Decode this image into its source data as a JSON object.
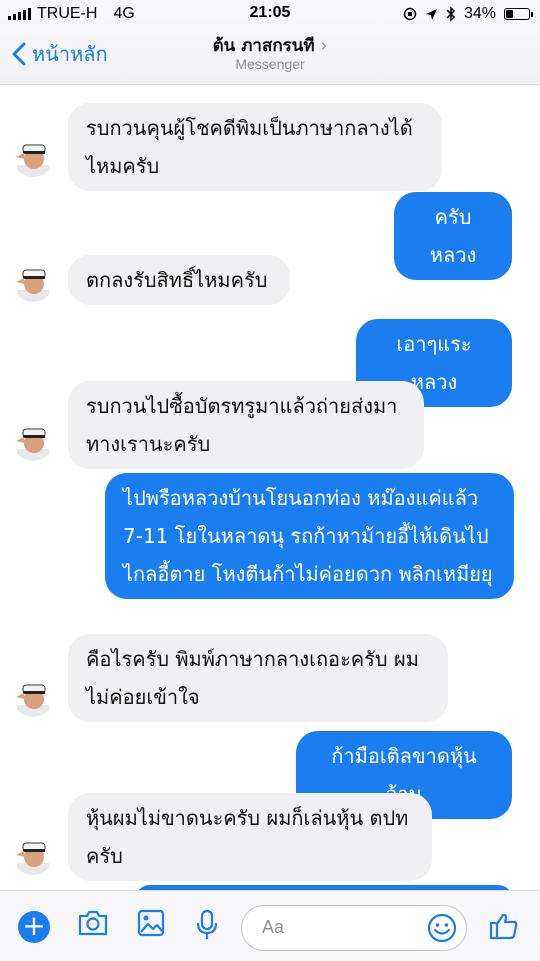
{
  "status_bar": {
    "carrier": "TRUE-H",
    "network": "4G",
    "time": "21:05",
    "battery": "34%"
  },
  "header": {
    "back_label": "หน้าหลัก",
    "contact_name": "ต้น ภาสกรนที",
    "subtitle": "Messenger"
  },
  "messages": [
    {
      "side": "in",
      "text": "รบกวนคุนผู้โชคดีพิมเป็นภาษากลางได้ไหมครับ"
    },
    {
      "side": "out",
      "text": "ครับหลวง"
    },
    {
      "side": "in",
      "text": "ตกลงรับสิทธิ์ไหมครับ"
    },
    {
      "side": "out",
      "text": "เอาๆแระหลวง"
    },
    {
      "side": "in",
      "text": "รบกวนไปซื้อบัตรทรูมาแล้วถ่ายส่งมาทางเรานะครับ"
    },
    {
      "side": "out",
      "text": "ไปพรือหลวงบ้านโยนอกท่อง หม๊องแค่แล้ว 7-11 โยในหลาดนุ รถก้าหาม้ายอี้ไห้เดินไปไกลอี้ตาย โหงตีนก้าไม่ค่อยดวก พลิกเหมียยุ"
    },
    {
      "side": "in",
      "text": "คือไรครับ พิมพ์ภาษากลางเถอะครับ ผมไม่ค่อยเข้าใจ"
    },
    {
      "side": "out",
      "text": "ก้ามือเติลขาดหุ้นจ้าน"
    },
    {
      "side": "in",
      "text": "หุ้นผมไม่ขาดนะครับ ผมก็เล่นหุ้น ตปทครับ"
    }
  ],
  "input": {
    "placeholder": "Aa"
  },
  "colors": {
    "accent": "#1a7df0",
    "incoming_bubble": "#f0f0f2"
  },
  "icons": [
    "back-chevron-icon",
    "plus-icon",
    "camera-icon",
    "gallery-icon",
    "microphone-icon",
    "emoji-icon",
    "like-thumb-icon"
  ]
}
